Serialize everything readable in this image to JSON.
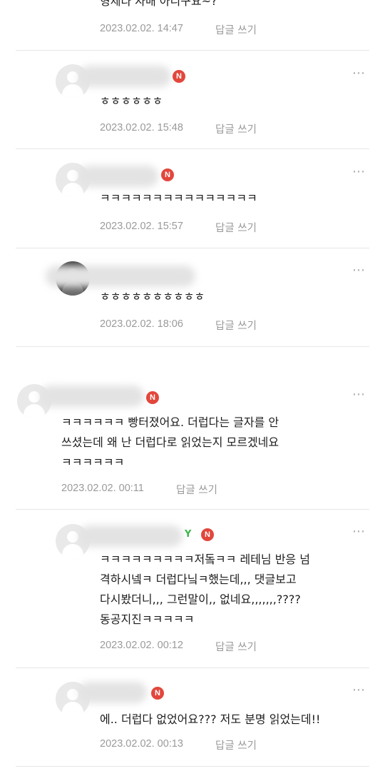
{
  "comments": [
    {
      "text": "형제다 자매 아니구요~?",
      "date": "2023.02.02. 14:47",
      "reply": "답글 쓰기"
    },
    {
      "text": "ㅎㅎㅎㅎㅎㅎ",
      "date": "2023.02.02. 15:48",
      "reply": "답글 쓰기"
    },
    {
      "text": "ㅋㅋㅋㅋㅋㅋㅋㅋㅋㅋㅋㅋㅋㅋㅋ",
      "date": "2023.02.02. 15:57",
      "reply": "답글 쓰기"
    },
    {
      "text": "ㅎㅎㅎㅎㅎㅎㅎㅎㅎㅎ",
      "date": "2023.02.02. 18:06",
      "reply": "답글 쓰기"
    },
    {
      "text": "ㅋㅋㅋㅋㅋㅋ 빵터졌어요. 더럽다는 글자를 안\n쓰셨는데 왜 난 더럽다로 읽었는지 모르겠네요\nㅋㅋㅋㅋㅋㅋ",
      "date": "2023.02.02. 00:11",
      "reply": "답글 쓰기"
    },
    {
      "text": "ㅋㅋㅋㅋㅋㅋㅋㅋㅋ저돜ㅋㅋ 레테님 반응 넘\n격하시넼ㅋ 더럽다닠ㅋ했는데,,, 댓글보고\n다시봤더니,,, 그런말이,, 없네요,,,,,,,????\n동공지진ㅋㅋㅋㅋㅋ",
      "date": "2023.02.02. 00:12",
      "reply": "답글 쓰기"
    },
    {
      "text": "에.. 더럽다 없었어요??? 저도 분명 읽었는데!!",
      "date": "2023.02.02. 00:13",
      "reply": "답글 쓰기"
    }
  ],
  "badge_letter": "N",
  "more_icon": "⋯",
  "colors": {
    "badge": "#e2473c",
    "meta": "#9a9a9a",
    "sprout": "#39b54a"
  }
}
